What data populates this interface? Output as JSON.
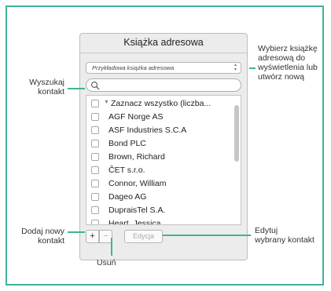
{
  "panel": {
    "title": "Książka adresowa",
    "book_select": "Przykładowa książka adresowa",
    "search_placeholder": "",
    "list_rows": [
      "Zaznacz wszystko (liczba...",
      "AGF Norge AS",
      "ASF Industries S.C.A",
      "Bond PLC",
      "Brown, Richard",
      "ČET s.r.o.",
      "Connor, William",
      "Dageo AG",
      "DupraisTel S.A.",
      "Heart, Jessica"
    ],
    "add_label": "+",
    "remove_label": "−",
    "edit_label": "Edycja"
  },
  "callouts": {
    "select_book": [
      "Wybierz książkę",
      "adresową do",
      "wyświetlenia lub",
      "utwórz nową"
    ],
    "search": [
      "Wyszukaj",
      "kontakt"
    ],
    "add": [
      "Dodaj nowy",
      "kontakt"
    ],
    "edit": [
      "Edytuj",
      "wybrany kontakt"
    ],
    "remove": [
      "Usuń"
    ]
  },
  "colors": {
    "accent": "#3fb49a"
  }
}
